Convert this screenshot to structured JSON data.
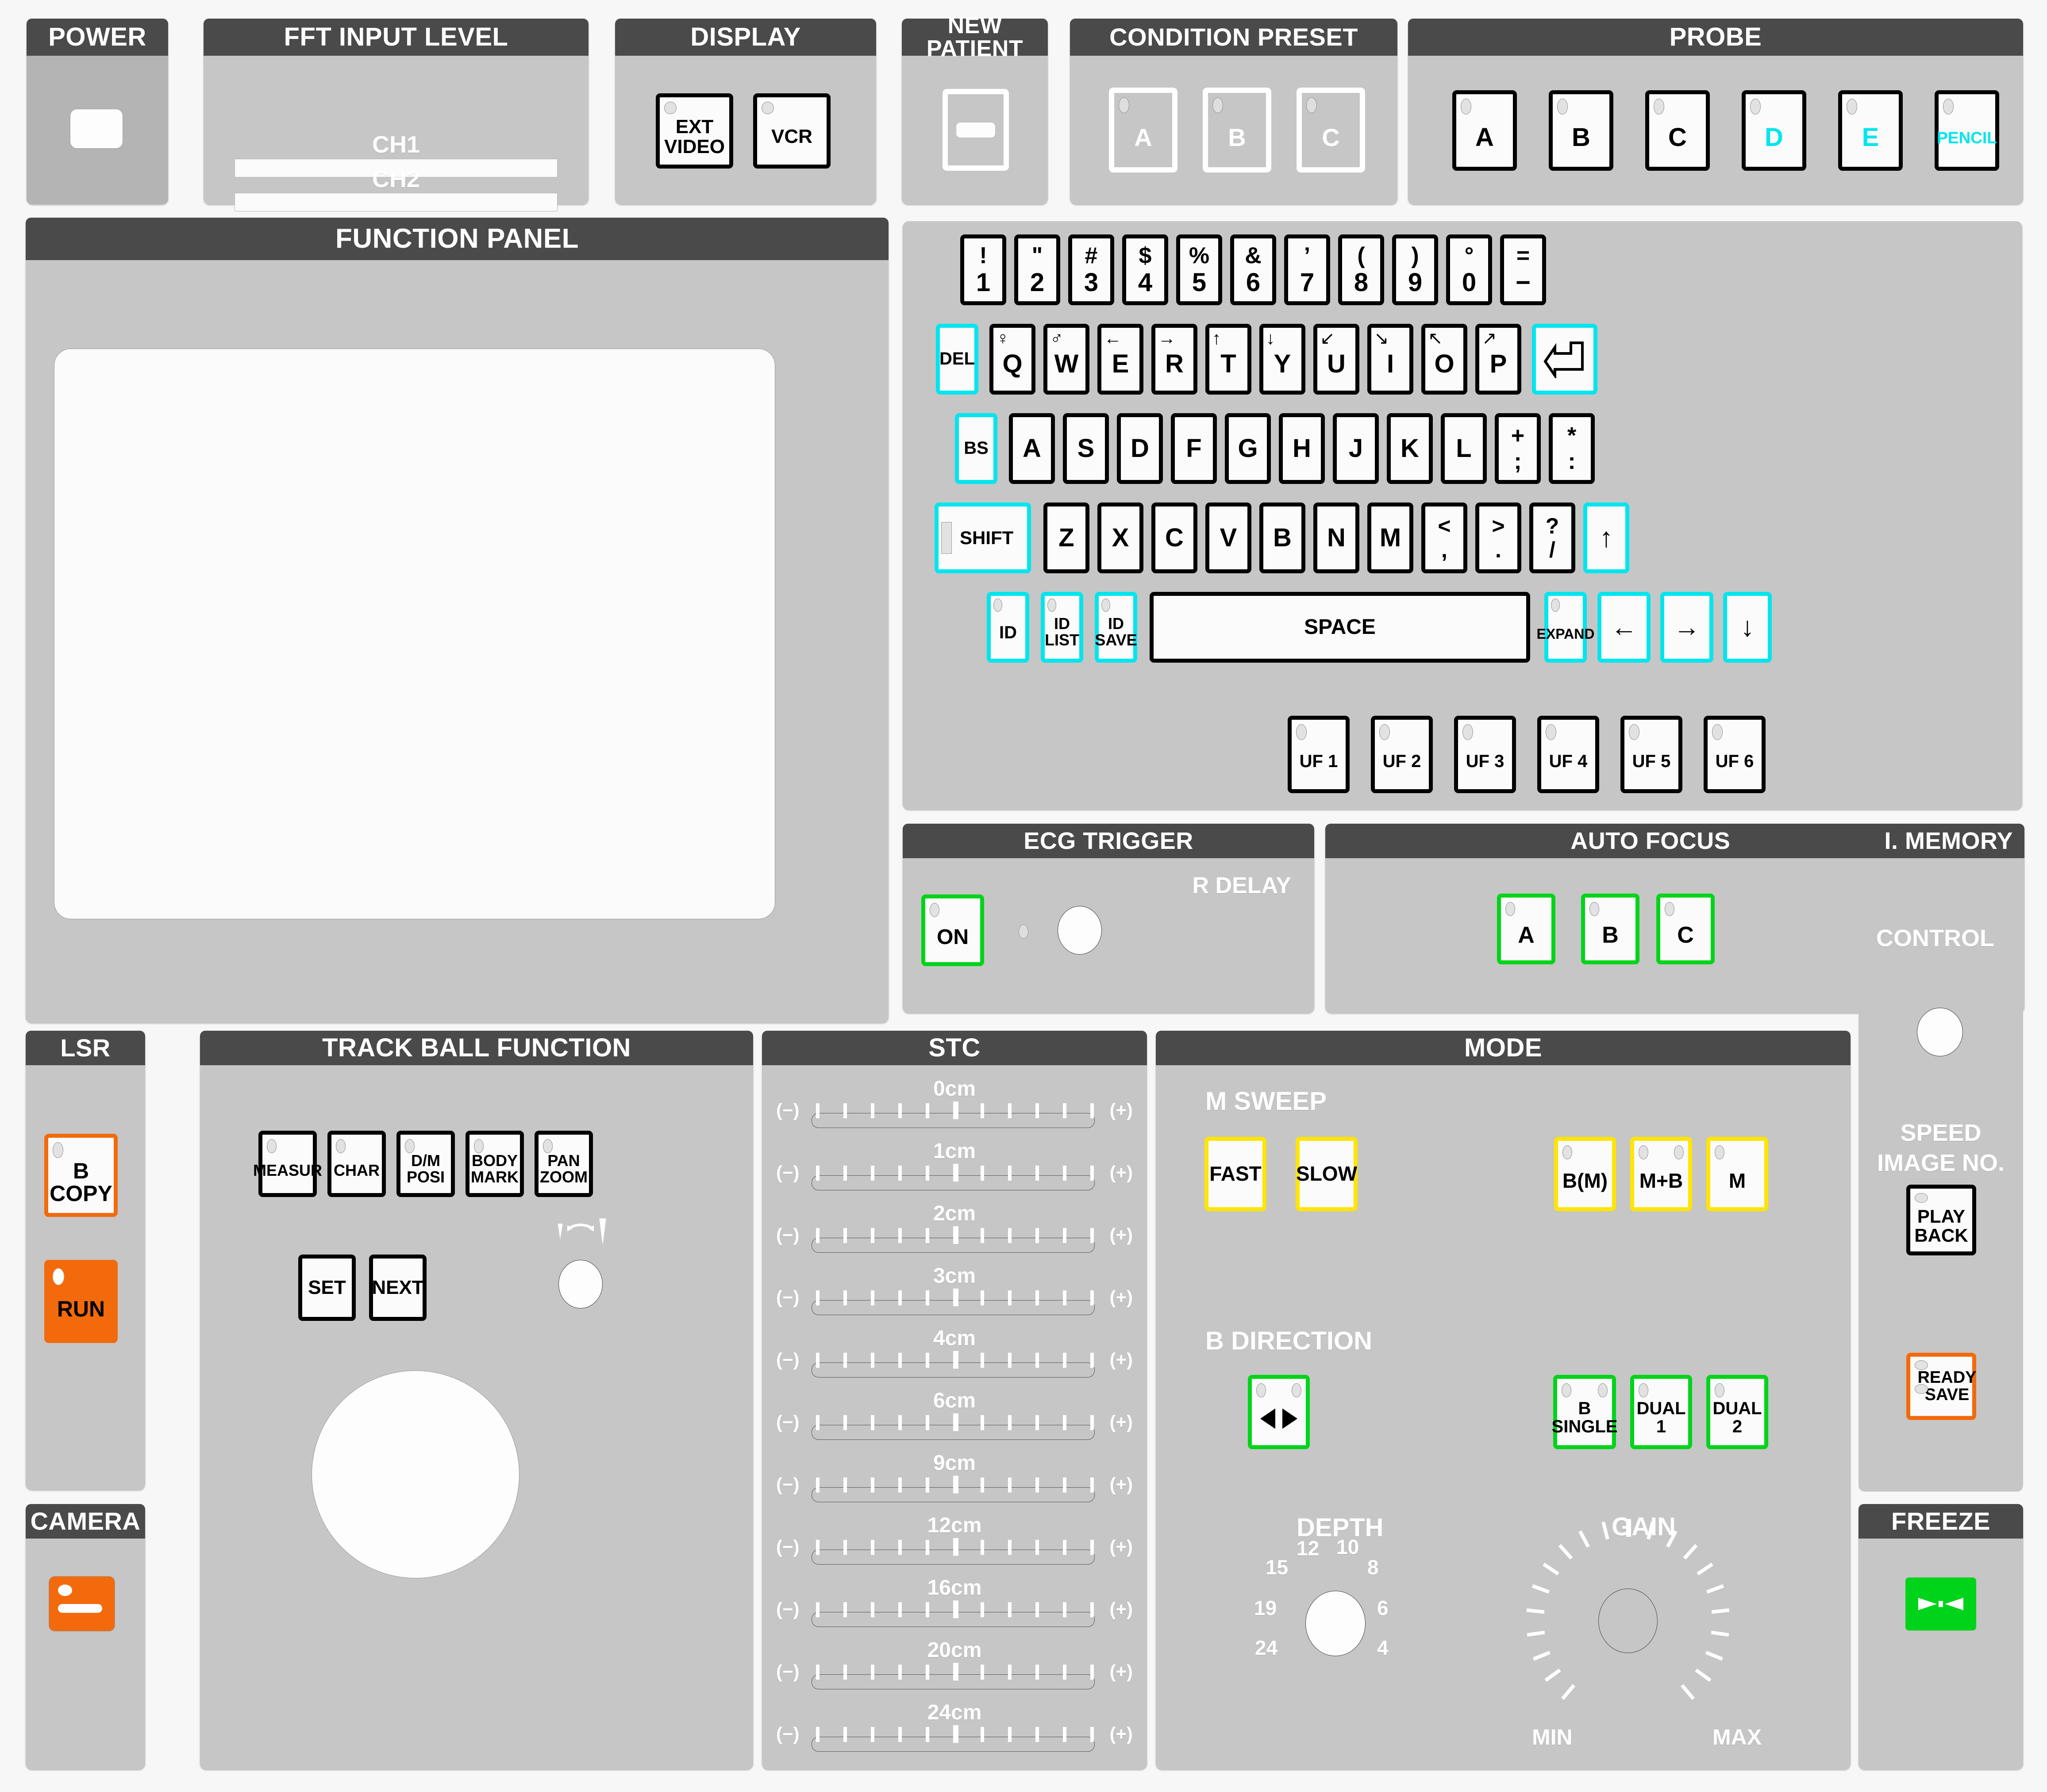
{
  "sections": {
    "power": {
      "title": "POWER"
    },
    "fft": {
      "title": "FFT INPUT LEVEL",
      "ch1": "CH1",
      "ch2": "CH2"
    },
    "display": {
      "title": "DISPLAY",
      "buttons": [
        {
          "label_line1": "EXT",
          "label_line2": "VIDEO"
        },
        {
          "label_line1": "VCR",
          "label_line2": ""
        }
      ]
    },
    "new_patient": {
      "title": "NEW PATIENT"
    },
    "condition_preset": {
      "title": "CONDITION PRESET",
      "buttons": [
        "A",
        "B",
        "C"
      ]
    },
    "probe": {
      "title": "PROBE",
      "buttons": [
        {
          "label": "A",
          "color": "black"
        },
        {
          "label": "B",
          "color": "black"
        },
        {
          "label": "C",
          "color": "black"
        },
        {
          "label": "D",
          "color": "cyan"
        },
        {
          "label": "E",
          "color": "cyan"
        },
        {
          "label": "PENCIL",
          "color": "cyan"
        }
      ]
    },
    "function_panel": {
      "title": "FUNCTION PANEL"
    },
    "ecg_trigger": {
      "title": "ECG TRIGGER",
      "r_delay": "R DELAY",
      "on": "ON"
    },
    "auto_focus": {
      "title": "AUTO FOCUS",
      "buttons": [
        "A",
        "B",
        "C"
      ]
    },
    "i_memory": {
      "title": "I. MEMORY",
      "control": "CONTROL",
      "speed": "SPEED",
      "image_no": "IMAGE NO.",
      "play_back_line1": "PLAY",
      "play_back_line2": "BACK",
      "ready_save_line1": "READY",
      "ready_save_line2": "SAVE"
    },
    "lsr": {
      "title": "LSR",
      "b_copy_line1": "B",
      "b_copy_line2": "COPY",
      "run": "RUN"
    },
    "camera": {
      "title": "CAMERA"
    },
    "track_ball": {
      "title": "TRACK BALL FUNCTION",
      "row1": [
        {
          "line1": "MEASUR",
          "line2": ""
        },
        {
          "line1": "CHAR",
          "line2": ""
        },
        {
          "line1": "D/M",
          "line2": "POSI"
        },
        {
          "line1": "BODY",
          "line2": "MARK"
        },
        {
          "line1": "PAN",
          "line2": "ZOOM"
        }
      ],
      "row2": [
        "SET",
        "NEXT"
      ]
    },
    "stc": {
      "title": "STC",
      "minus": "(−)",
      "plus": "(+)",
      "labels": [
        "0cm",
        "1cm",
        "2cm",
        "3cm",
        "4cm",
        "6cm",
        "9cm",
        "12cm",
        "16cm",
        "20cm",
        "24cm"
      ]
    },
    "mode": {
      "title": "MODE",
      "m_sweep": "M SWEEP",
      "m_sweep_buttons": [
        "FAST",
        "SLOW"
      ],
      "mode_buttons": [
        "B(M)",
        "M+B",
        "M"
      ],
      "b_direction": "B DIRECTION",
      "b_buttons": [
        {
          "line1": "B",
          "line2": "SINGLE"
        },
        {
          "line1": "DUAL",
          "line2": "1"
        },
        {
          "line1": "DUAL",
          "line2": "2"
        }
      ],
      "depth": {
        "label": "DEPTH",
        "marks": [
          "12",
          "10",
          "15",
          "8",
          "19",
          "6",
          "24",
          "4"
        ]
      },
      "gain": {
        "label": "GAIN",
        "min": "MIN",
        "max": "MAX"
      }
    },
    "freeze": {
      "title": "FREEZE"
    }
  },
  "keyboard": {
    "number_row": [
      {
        "top": "!",
        "bottom": "1"
      },
      {
        "top": "\"",
        "bottom": "2"
      },
      {
        "top": "#",
        "bottom": "3"
      },
      {
        "top": "$",
        "bottom": "4"
      },
      {
        "top": "%",
        "bottom": "5"
      },
      {
        "top": "&",
        "bottom": "6"
      },
      {
        "top": "’",
        "bottom": "7"
      },
      {
        "top": "(",
        "bottom": "8"
      },
      {
        "top": ")",
        "bottom": "9"
      },
      {
        "top": "°",
        "bottom": "0"
      },
      {
        "top": "=",
        "bottom": "−"
      }
    ],
    "row_q": {
      "del": "DEL",
      "keys": [
        {
          "letter": "Q",
          "sup": "♀"
        },
        {
          "letter": "W",
          "sup": "♂"
        },
        {
          "letter": "E",
          "sup": "←"
        },
        {
          "letter": "R",
          "sup": "→"
        },
        {
          "letter": "T",
          "sup": "↑"
        },
        {
          "letter": "Y",
          "sup": "↓"
        },
        {
          "letter": "U",
          "sup": "↙"
        },
        {
          "letter": "I",
          "sup": "↘"
        },
        {
          "letter": "O",
          "sup": "↖"
        },
        {
          "letter": "P",
          "sup": "↗"
        }
      ],
      "enter": "↵"
    },
    "row_a": {
      "bs": "BS",
      "keys": [
        "A",
        "S",
        "D",
        "F",
        "G",
        "H",
        "J",
        "K",
        "L"
      ],
      "punct": [
        {
          "top": "+",
          "bottom": ";"
        },
        {
          "top": "*",
          "bottom": ":"
        }
      ]
    },
    "row_z": {
      "shift": "SHIFT",
      "keys": [
        "Z",
        "X",
        "C",
        "V",
        "B",
        "N",
        "M"
      ],
      "punct": [
        {
          "top": "<",
          "bottom": ","
        },
        {
          "top": ">",
          "bottom": "."
        },
        {
          "top": "?",
          "bottom": "/"
        }
      ],
      "up": "↑"
    },
    "row_space": {
      "id": "ID",
      "id_list_line1": "ID",
      "id_list_line2": "LIST",
      "id_save_line1": "ID",
      "id_save_line2": "SAVE",
      "space": "SPACE",
      "expand": "EXPAND",
      "left": "←",
      "right": "→",
      "down": "↓"
    },
    "uf_keys": [
      "UF 1",
      "UF 2",
      "UF 3",
      "UF 4",
      "UF 5",
      "UF 6"
    ]
  },
  "colors": {
    "panel_bg": "#c6c6c6",
    "header_bg": "#4a4a4a",
    "cyan": "#00e5ee",
    "green": "#00d41a",
    "yellow": "#ffe500",
    "orange": "#f26a0c"
  }
}
